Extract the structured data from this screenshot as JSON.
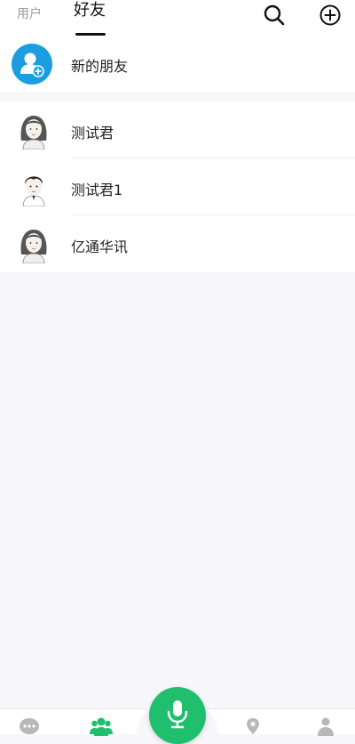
{
  "header": {
    "tabs": [
      {
        "label": "用户",
        "active": false
      },
      {
        "label": "好友",
        "active": true
      }
    ],
    "icons": [
      "search-icon",
      "add-circle-icon"
    ]
  },
  "new_friends": {
    "label": "新的朋友",
    "icon": "add-user-icon",
    "icon_color": "#1a9ee0"
  },
  "friends": [
    {
      "name": "测试君",
      "avatar": "female-avatar-icon"
    },
    {
      "name": "测试君1",
      "avatar": "male-avatar-icon"
    },
    {
      "name": "亿通华讯",
      "avatar": "female-avatar-icon"
    }
  ],
  "bottom_nav": {
    "items": [
      "chat-icon",
      "contacts-icon",
      "mic-icon",
      "location-icon",
      "profile-icon"
    ],
    "active": "contacts-icon",
    "active_color": "#1fbf6e",
    "inactive_color": "#b8b8b8"
  }
}
